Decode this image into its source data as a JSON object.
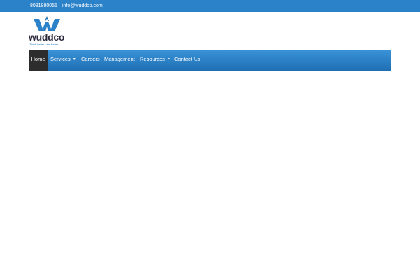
{
  "colors": {
    "topbar": "#2b82c9",
    "nav_active": "#2d2d2d"
  },
  "topbar": {
    "phone": "8081880055",
    "email": "info@wuddco.com"
  },
  "logo": {
    "brand": "wuddco",
    "tagline": "Think better Live Better",
    "icon": "wuddco-w-logo-icon"
  },
  "nav": {
    "items": [
      {
        "label": "Home",
        "active": true
      },
      {
        "label": "Services",
        "has_dropdown": true
      },
      {
        "label": "Careers"
      },
      {
        "label": "Management"
      },
      {
        "label": "Resources",
        "has_dropdown": true
      },
      {
        "label": "Contact Us"
      }
    ]
  }
}
